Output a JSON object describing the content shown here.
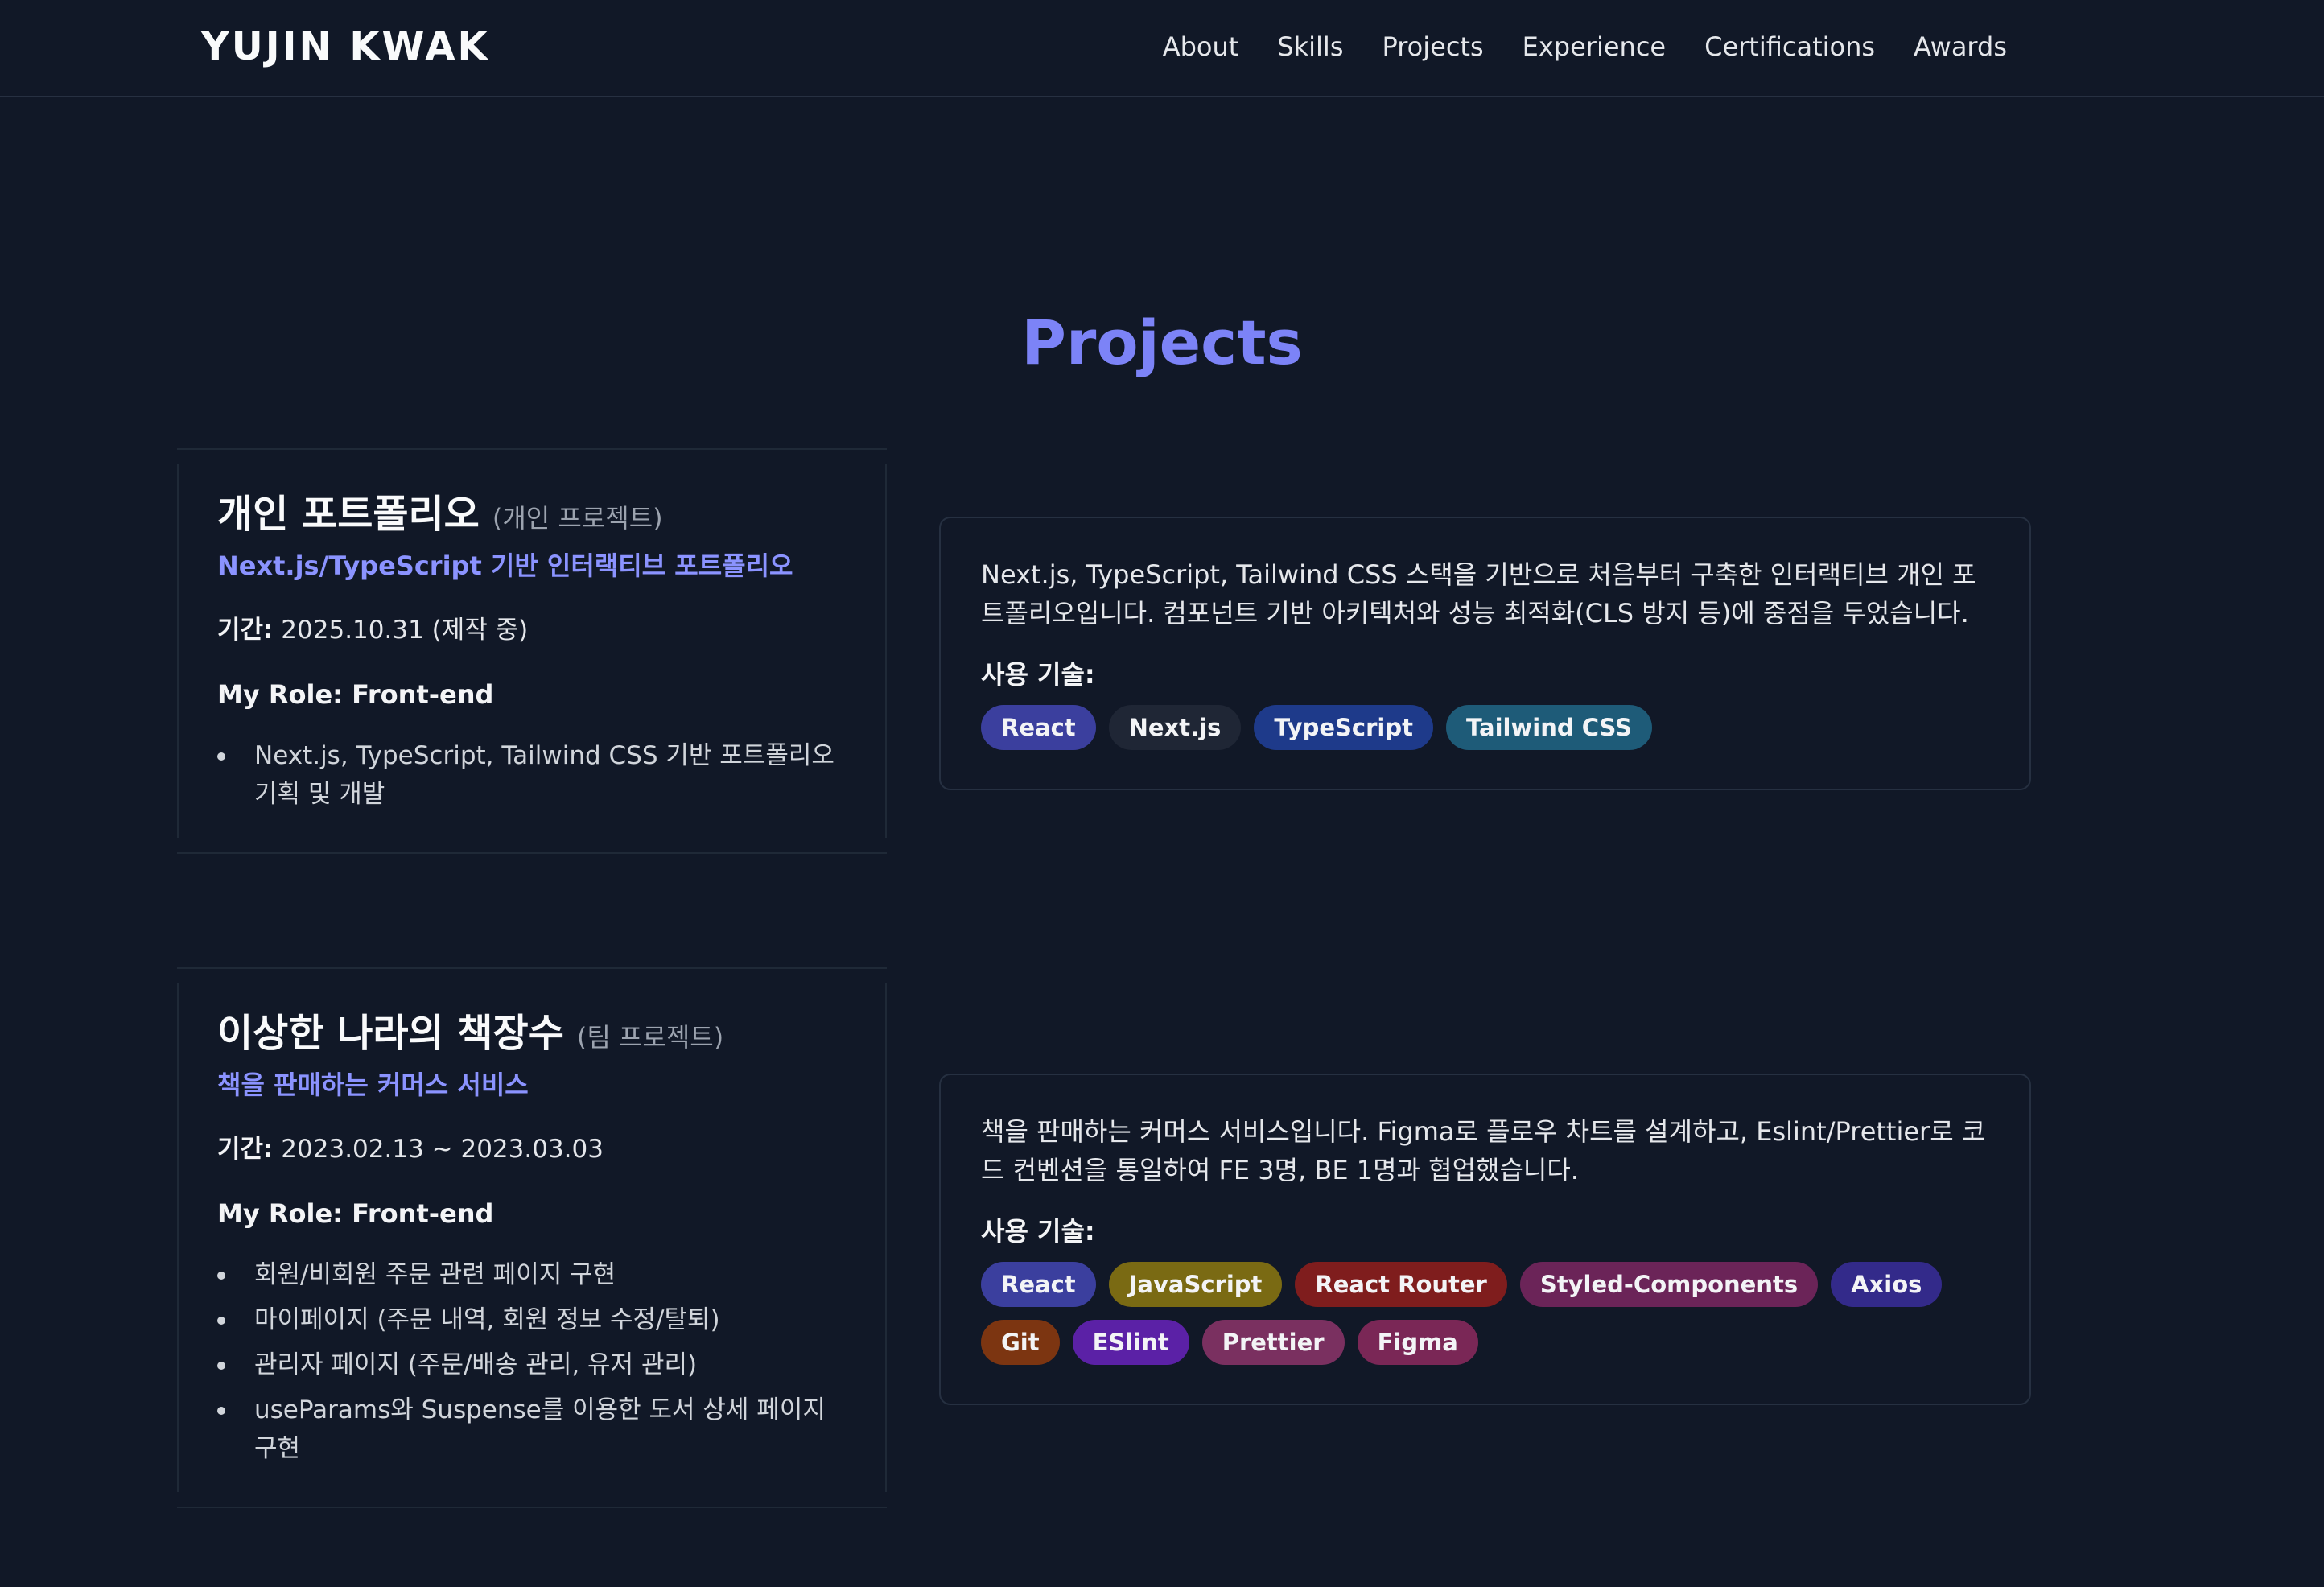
{
  "header": {
    "brand": "YUJIN KWAK",
    "nav": [
      "About",
      "Skills",
      "Projects",
      "Experience",
      "Certifications",
      "Awards"
    ]
  },
  "section": {
    "title": "Projects"
  },
  "projects": [
    {
      "name": "개인 포트폴리오",
      "type": "(개인 프로젝트)",
      "subtitle": "Next.js/TypeScript 기반 인터랙티브 포트폴리오",
      "period_label": "기간:",
      "period": "2025.10.31 (제작 중)",
      "role": "My Role: Front-end",
      "bullets": [
        "Next.js, TypeScript, Tailwind CSS 기반 포트폴리오 기획 및 개발"
      ],
      "description": "Next.js, TypeScript, Tailwind CSS 스택을 기반으로 처음부터 구축한 인터랙티브 개인 포트폴리오입니다. 컴포넌트 기반 아키텍처와 성능 최적화(CLS 방지 등)에 중점을 두었습니다.",
      "tech_label": "사용 기술:",
      "tags": [
        {
          "name": "React",
          "color": "#3b3f9e"
        },
        {
          "name": "Next.js",
          "color": "#1f2635"
        },
        {
          "name": "TypeScript",
          "color": "#1e3a8a"
        },
        {
          "name": "Tailwind CSS",
          "color": "#1e5b78"
        }
      ]
    },
    {
      "name": "이상한 나라의 책장수",
      "type": "(팀 프로젝트)",
      "subtitle": "책을 판매하는 커머스 서비스",
      "period_label": "기간:",
      "period": "2023.02.13 ~ 2023.03.03",
      "role": "My Role: Front-end",
      "bullets": [
        "회원/비회원 주문 관련 페이지 구현",
        "마이페이지 (주문 내역, 회원 정보 수정/탈퇴)",
        "관리자 페이지 (주문/배송 관리, 유저 관리)",
        "useParams와 Suspense를 이용한 도서 상세 페이지 구현"
      ],
      "description": "책을 판매하는 커머스 서비스입니다. Figma로 플로우 차트를 설계하고, Eslint/Prettier로 코드 컨벤션을 통일하여 FE 3명, BE 1명과 협업했습니다.",
      "tech_label": "사용 기술:",
      "tags": [
        {
          "name": "React",
          "color": "#3b3f9e"
        },
        {
          "name": "JavaScript",
          "color": "#7a6a13"
        },
        {
          "name": "React Router",
          "color": "#7f1d1d"
        },
        {
          "name": "Styled-Components",
          "color": "#6b2458"
        },
        {
          "name": "Axios",
          "color": "#332a8a"
        },
        {
          "name": "Git",
          "color": "#7c3511"
        },
        {
          "name": "ESlint",
          "color": "#5b21a6"
        },
        {
          "name": "Prettier",
          "color": "#7a3060"
        },
        {
          "name": "Figma",
          "color": "#7a2756"
        }
      ]
    }
  ]
}
